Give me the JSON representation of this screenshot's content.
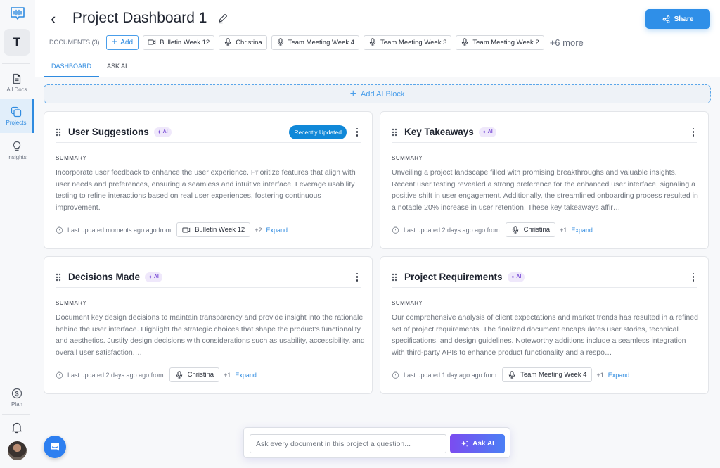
{
  "sidebar": {
    "workspace_initial": "T",
    "items": [
      {
        "label": "All Docs",
        "icon": "document-icon",
        "active": false
      },
      {
        "label": "Projects",
        "icon": "projects-icon",
        "active": true
      },
      {
        "label": "Insights",
        "icon": "lightbulb-icon",
        "active": false
      }
    ],
    "bottom_items": [
      {
        "label": "Plan",
        "icon": "dollar-icon"
      }
    ]
  },
  "header": {
    "title": "Project Dashboard 1",
    "share_label": "Share",
    "documents_label": "DOCUMENTS (3)",
    "add_label": "Add",
    "documents": [
      {
        "name": "Bulletin Week 12",
        "type": "video"
      },
      {
        "name": "Christina",
        "type": "audio"
      },
      {
        "name": "Team Meeting Week 4",
        "type": "audio"
      },
      {
        "name": "Team Meeting Week 3",
        "type": "audio"
      },
      {
        "name": "Team Meeting Week 2",
        "type": "audio"
      }
    ],
    "more_label": "+6 more",
    "tabs": [
      {
        "label": "DASHBOARD",
        "active": true
      },
      {
        "label": "ASK AI",
        "active": false
      }
    ]
  },
  "add_block_label": "Add AI Block",
  "cards": [
    {
      "title": "User Suggestions",
      "ai_badge": "AI",
      "status_badge": "Recently Updated",
      "summary_label": "SUMMARY",
      "summary": "Incorporate user feedback to enhance the user experience. Prioritize features that align with user needs and preferences, ensuring a seamless and intuitive interface. Leverage usability testing to refine interactions based on real user experiences, fostering continuous improvement.",
      "updated_text": "Last updated moments ago ago from",
      "source": {
        "name": "Bulletin Week 12",
        "type": "video"
      },
      "extra_count": "+2",
      "expand_label": "Expand"
    },
    {
      "title": "Key Takeaways",
      "ai_badge": "AI",
      "summary_label": "SUMMARY",
      "summary": "Unveiling a project landscape filled with promising breakthroughs and valuable insights. Recent user testing revealed a strong preference for the enhanced user interface, signaling a positive shift in user engagement. Additionally, the streamlined onboarding process resulted in a notable 20% increase in user retention. These key takeaways affir…",
      "updated_text": "Last updated 2 days ago ago from",
      "source": {
        "name": "Christina",
        "type": "audio"
      },
      "extra_count": "+1",
      "expand_label": "Expand"
    },
    {
      "title": "Decisions Made",
      "ai_badge": "AI",
      "summary_label": "SUMMARY",
      "summary": "Document key design decisions to maintain transparency and provide insight into the rationale behind the user interface. Highlight the strategic choices that shape the product's functionality and aesthetics. Justify design decisions with considerations such as usability, accessibility, and overall user satisfaction.…",
      "updated_text": "Last updated 2 days ago ago from",
      "source": {
        "name": "Christina",
        "type": "audio"
      },
      "extra_count": "+1",
      "expand_label": "Expand"
    },
    {
      "title": "Project Requirements",
      "ai_badge": "AI",
      "summary_label": "SUMMARY",
      "summary": "Our comprehensive analysis of client expectations and market trends has resulted in a refined set of project requirements. The finalized document encapsulates user stories, technical specifications, and design guidelines. Noteworthy additions include a seamless integration with third-party APIs to enhance product functionality and a respo…",
      "updated_text": "Last updated 1 day ago ago from",
      "source": {
        "name": "Team Meeting Week 4",
        "type": "audio"
      },
      "extra_count": "+1",
      "expand_label": "Expand"
    }
  ],
  "ask_bar": {
    "placeholder": "Ask every document in this project a question...",
    "button_label": "Ask AI"
  },
  "colors": {
    "accent": "#2f8be0",
    "share_button": "#2f8fe8",
    "recently_updated": "#1088d8",
    "ai_badge_bg": "#efe8fb",
    "ai_badge_text": "#7b4fd6",
    "ask_ai_gradient_start": "#7b4cf0",
    "ask_ai_gradient_end": "#4b7ff5"
  }
}
